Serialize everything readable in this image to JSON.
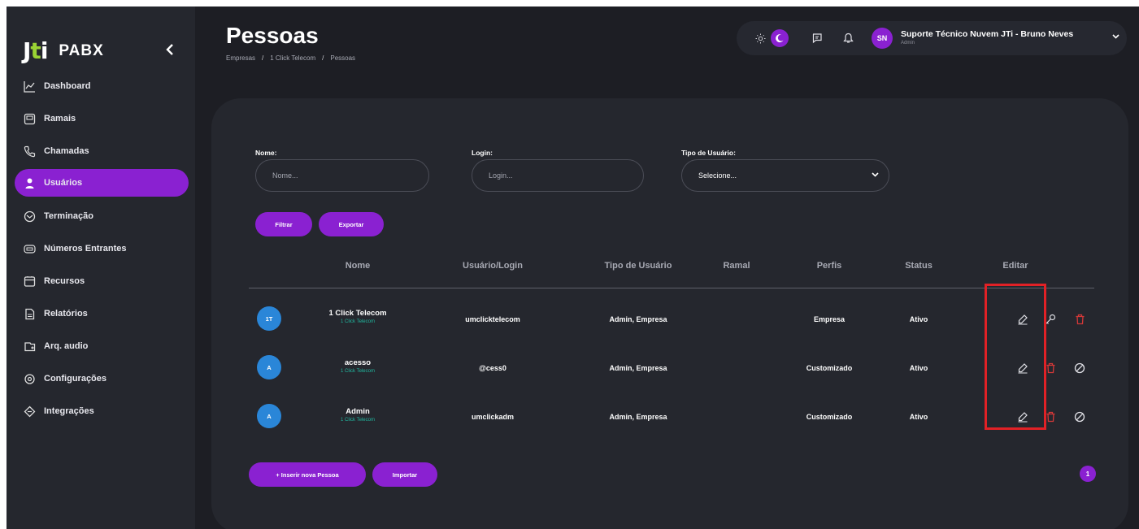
{
  "app": {
    "logo_mark": "Jti",
    "product": "PABX",
    "collapse_icon": "chevron-left-icon"
  },
  "sidebar": {
    "items": [
      {
        "label": "Dashboard",
        "icon": "chart-line-icon",
        "active": false
      },
      {
        "label": "Ramais",
        "icon": "phone-extension-icon",
        "active": false
      },
      {
        "label": "Chamadas",
        "icon": "phone-call-icon",
        "active": false
      },
      {
        "label": "Usuários",
        "icon": "user-icon",
        "active": true
      },
      {
        "label": "Terminação",
        "icon": "terminal-icon",
        "active": false
      },
      {
        "label": "Números Entrantes",
        "icon": "keypad-icon",
        "active": false
      },
      {
        "label": "Recursos",
        "icon": "resources-icon",
        "active": false
      },
      {
        "label": "Relatórios",
        "icon": "report-icon",
        "active": false
      },
      {
        "label": "Arq. audio",
        "icon": "audio-file-icon",
        "active": false
      },
      {
        "label": "Configurações",
        "icon": "settings-icon",
        "active": false
      },
      {
        "label": "Integrações",
        "icon": "integration-icon",
        "active": false
      }
    ]
  },
  "header": {
    "title": "Pessoas",
    "breadcrumb": [
      "Empresas",
      "1 Click Telecom",
      "Pessoas"
    ],
    "breadcrumb_sep": "/"
  },
  "topbar": {
    "avatar_initials": "SN",
    "user_name": "Suporte Técnico Nuvem JTi - Bruno Neves",
    "user_role": "Admin"
  },
  "filters": {
    "nome_label": "Nome:",
    "nome_placeholder": "Nome...",
    "login_label": "Login:",
    "login_placeholder": "Login...",
    "tipo_label": "Tipo de Usuário:",
    "tipo_value": "Selecione...",
    "filtrar": "Filtrar",
    "exportar": "Exportar"
  },
  "table": {
    "columns": [
      "Nome",
      "Usuário/Login",
      "Tipo de Usuário",
      "Ramal",
      "Perfis",
      "Status",
      "Editar"
    ],
    "rows": [
      {
        "initials": "1T",
        "name": "1 Click Telecom",
        "company": "1 Click Telecom",
        "login": "umclicktelecom",
        "tipo": "Admin, Empresa",
        "ramal": "",
        "perfil": "Empresa",
        "status": "Ativo"
      },
      {
        "initials": "A",
        "name": "acesso",
        "company": "1 Click Telecom",
        "login": "@cess0",
        "tipo": "Admin, Empresa",
        "ramal": "",
        "perfil": "Customizado",
        "status": "Ativo"
      },
      {
        "initials": "A",
        "name": "Admin",
        "company": "1 Click Telecom",
        "login": "umclickadm",
        "tipo": "Admin, Empresa",
        "ramal": "",
        "perfil": "Customizado",
        "status": "Ativo"
      }
    ]
  },
  "footer": {
    "inserir": "+ Inserir nova Pessoa",
    "importar": "Importar",
    "page": "1"
  },
  "colors": {
    "accent": "#8a21d1",
    "avatar_blue": "#2a86d8",
    "subtext_teal": "#21b8a0",
    "delete_red": "#d33838",
    "highlight_red": "#e12126"
  }
}
